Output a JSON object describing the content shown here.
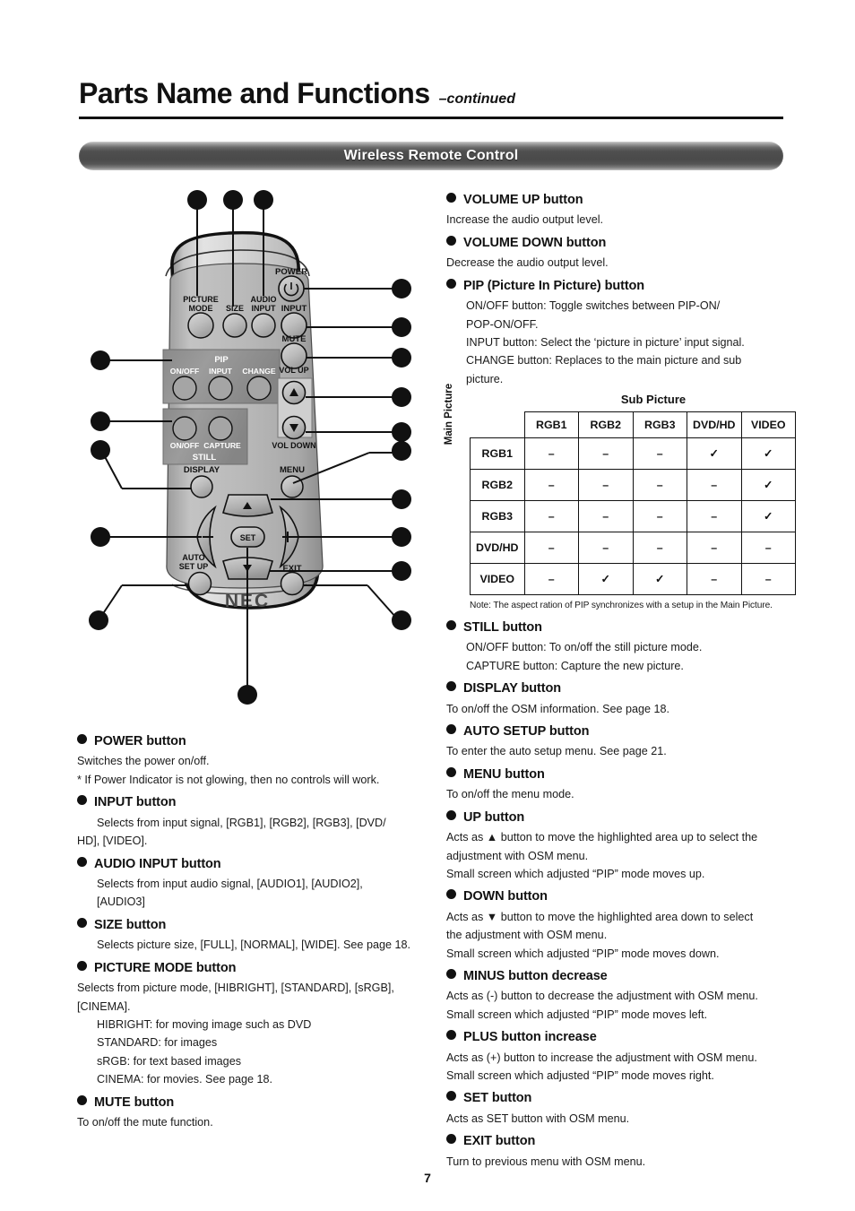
{
  "header": {
    "title": "Parts Name and Functions",
    "continued": "–continued",
    "section_banner": "Wireless Remote Control"
  },
  "remote": {
    "brand": "NEC",
    "labels": {
      "power": "POWER",
      "picture_mode_line1": "PICTURE",
      "picture_mode_line2": "MODE",
      "size": "SIZE",
      "audio_input_line1": "AUDIO",
      "audio_input_line2": "INPUT",
      "input": "INPUT",
      "mute": "MUTE",
      "pip": "PIP",
      "pip_onoff": "ON/OFF",
      "pip_input": "INPUT",
      "pip_change": "CHANGE",
      "still": "STILL",
      "still_onoff": "ON/OFF",
      "still_capture": "CAPTURE",
      "vol_up": "VOL UP",
      "vol_down": "VOL DOWN",
      "display": "DISPLAY",
      "menu": "MENU",
      "auto_setup_line1": "AUTO",
      "auto_setup_line2": "SET UP",
      "exit": "EXIT",
      "set": "SET",
      "minus": "–",
      "plus": "+",
      "up_arrow": "▲",
      "down_arrow": "▼"
    }
  },
  "left_column": {
    "items": [
      {
        "title": "POWER button",
        "lines": [
          {
            "text": "Switches the power on/off.",
            "indent": 0
          },
          {
            "text": "* If Power Indicator is not glowing, then no controls will work.",
            "indent": 0
          }
        ]
      },
      {
        "title": "INPUT button",
        "lines": [
          {
            "text": "Selects from input signal, [RGB1],  [RGB2],  [RGB3], [DVD/",
            "indent": 1
          },
          {
            "text": "HD],  [VIDEO].",
            "indent": 0
          }
        ]
      },
      {
        "title": "AUDIO INPUT button",
        "lines": [
          {
            "text": "Selects from input audio signal, [AUDIO1], [AUDIO2],",
            "indent": 1
          },
          {
            "text": "[AUDIO3]",
            "indent": 1
          }
        ]
      },
      {
        "title": "SIZE button",
        "lines": [
          {
            "text": "Selects picture size, [FULL], [NORMAL], [WIDE]. See page 18.",
            "indent": 1
          }
        ]
      },
      {
        "title": "PICTURE MODE button",
        "lines": [
          {
            "text": "Selects from picture mode, [HIBRIGHT],  [STANDARD],  [sRGB],",
            "indent": 0
          },
          {
            "text": "[CINEMA].",
            "indent": 0
          },
          {
            "text": "HIBRIGHT: for moving image such as DVD",
            "indent": 1
          },
          {
            "text": "STANDARD: for images",
            "indent": 1
          },
          {
            "text": "sRGB: for text based images",
            "indent": 1
          },
          {
            "text": "CINEMA: for movies.  See page 18.",
            "indent": 1
          }
        ]
      },
      {
        "title": "MUTE button",
        "lines": [
          {
            "text": "To on/off the mute function.",
            "indent": 0
          }
        ]
      }
    ]
  },
  "right_column": {
    "items_before_table": [
      {
        "title": "VOLUME UP button",
        "lines": [
          {
            "text": "Increase the audio output level.",
            "indent": 0
          }
        ]
      },
      {
        "title": "VOLUME DOWN button",
        "lines": [
          {
            "text": "Decrease the audio output level.",
            "indent": 0
          }
        ]
      },
      {
        "title": "PIP (Picture In Picture) button",
        "lines": [
          {
            "text": "ON/OFF button: Toggle switches between PIP-ON/",
            "indent": 1
          },
          {
            "text": "POP-ON/OFF.",
            "indent": 1
          },
          {
            "text": "INPUT button: Select the ‘picture in picture’ input signal.",
            "indent": 1
          },
          {
            "text": "CHANGE button: Replaces to the main picture and sub",
            "indent": 1
          },
          {
            "text": "picture.",
            "indent": 1
          }
        ]
      }
    ],
    "items_after_table": [
      {
        "title": "STILL button",
        "lines": [
          {
            "text": "ON/OFF button: To on/off the still picture mode.",
            "indent": 1
          },
          {
            "text": "CAPTURE button: Capture the new picture.",
            "indent": 1
          }
        ]
      },
      {
        "title": "DISPLAY button",
        "lines": [
          {
            "text": "To on/off the OSM information.  See page 18.",
            "indent": 0
          }
        ]
      },
      {
        "title": "AUTO SETUP button",
        "lines": [
          {
            "text": "To enter the auto setup menu.  See page 21.",
            "indent": 0
          }
        ]
      },
      {
        "title": "MENU button",
        "lines": [
          {
            "text": "To on/off the menu mode.",
            "indent": 0
          }
        ]
      },
      {
        "title": "UP button",
        "lines": [
          {
            "text": "Acts as ▲  button to move the highlighted area up to select the",
            "indent": 0
          },
          {
            "text": "adjustment with OSM menu.",
            "indent": 0
          },
          {
            "text": "Small screen which adjusted “PIP” mode moves up.",
            "indent": 0
          }
        ]
      },
      {
        "title": "DOWN button",
        "lines": [
          {
            "text": "Acts as ▼  button to move the highlighted area down to select",
            "indent": 0
          },
          {
            "text": "the adjustment with OSM menu.",
            "indent": 0
          },
          {
            "text": "Small screen which adjusted “PIP” mode moves down.",
            "indent": 0
          }
        ]
      },
      {
        "title": "MINUS button decrease",
        "lines": [
          {
            "text": "Acts as (-) button to decrease the adjustment with OSM menu.",
            "indent": 0
          },
          {
            "text": "Small screen which adjusted “PIP” mode moves left.",
            "indent": 0
          }
        ]
      },
      {
        "title": "PLUS button increase",
        "lines": [
          {
            "text": "Acts as (+) button to increase the adjustment with OSM menu.",
            "indent": 0
          },
          {
            "text": "Small screen which adjusted “PIP” mode moves right.",
            "indent": 0
          }
        ]
      },
      {
        "title": "SET button",
        "lines": [
          {
            "text": "Acts as SET button with OSM menu.",
            "indent": 0
          }
        ]
      },
      {
        "title": "EXIT button",
        "lines": [
          {
            "text": "Turn to previous menu with OSM menu.",
            "indent": 0
          }
        ]
      }
    ]
  },
  "pip_table": {
    "sub_picture_label": "Sub Picture",
    "main_picture_label": "Main Picture",
    "columns": [
      "RGB1",
      "RGB2",
      "RGB3",
      "DVD/HD",
      "VIDEO"
    ],
    "rows": [
      {
        "label": "RGB1",
        "cells": [
          "–",
          "–",
          "–",
          "✓",
          "✓"
        ]
      },
      {
        "label": "RGB2",
        "cells": [
          "–",
          "–",
          "–",
          "–",
          "✓"
        ]
      },
      {
        "label": "RGB3",
        "cells": [
          "–",
          "–",
          "–",
          "–",
          "✓"
        ]
      },
      {
        "label": "DVD/HD",
        "cells": [
          "–",
          "–",
          "–",
          "–",
          "–"
        ]
      },
      {
        "label": "VIDEO",
        "cells": [
          "–",
          "✓",
          "✓",
          "–",
          "–"
        ]
      }
    ],
    "note": "Note: The aspect ration of PIP synchronizes with a setup in the Main Picture."
  },
  "footer": {
    "page_number": "7"
  },
  "colors": {
    "ink": "#111111",
    "banner_dark": "#4a4a4a",
    "remote_body": "#b5b5b5",
    "remote_panel": "#9a9a9a"
  }
}
